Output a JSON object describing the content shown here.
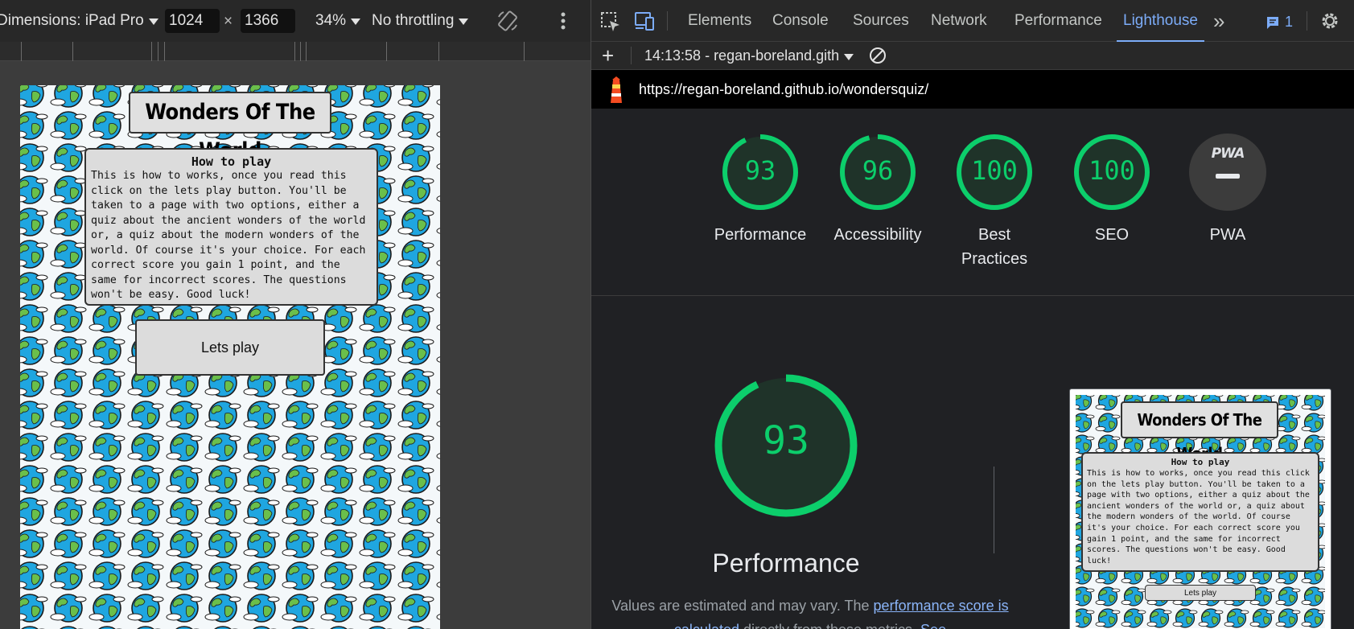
{
  "device_toolbar": {
    "dimensions_label": "Dimensions: iPad Pro",
    "width_value": "1024",
    "times_sign": "×",
    "height_value": "1366",
    "zoom": "34%",
    "throttling": "No throttling"
  },
  "quiz": {
    "title": "Wonders Of The World",
    "how_to_play_heading": "How to play",
    "how_to_play_text": "This is how to works, once you read this click on the lets play button. You'll be taken to a page with two options, either a quiz about the ancient wonders of the world or, a quiz about the modern wonders of the world. Of course it's your choice. For each correct score you gain 1 point, and the same for incorrect scores. The questions won't be easy. Good luck!",
    "play_button": "Lets play"
  },
  "devtools": {
    "tabs": [
      "Elements",
      "Console",
      "Sources",
      "Network",
      "Performance",
      "Lighthouse"
    ],
    "active_tab": "Lighthouse",
    "more_tabs": "»",
    "issues_count": "1",
    "report_selector": "14:13:58 - regan-boreland.gith",
    "url": "https://regan-boreland.github.io/wondersquiz/"
  },
  "lighthouse": {
    "gauges": [
      {
        "label": "Performance",
        "score": "93",
        "value": 93
      },
      {
        "label": "Accessibility",
        "score": "96",
        "value": 96
      },
      {
        "label": "Best Practices",
        "score": "100",
        "value": 100
      },
      {
        "label": "SEO",
        "score": "100",
        "value": 100
      }
    ],
    "pwa_label": "PWA",
    "pwa_badge": "PWA",
    "big_score": "93",
    "big_score_value": 93,
    "big_label": "Performance",
    "note_prefix": "Values are estimated and may vary. The ",
    "note_link": "performance score is calculated",
    "note_suffix": " directly from these metrics. ",
    "note_link2": "See"
  },
  "colors": {
    "pass_green": "#0cce6b",
    "gauge_fill": "#1f3329",
    "pwa_grey": "#3c3c3c",
    "accent_blue": "#7cacf8"
  }
}
